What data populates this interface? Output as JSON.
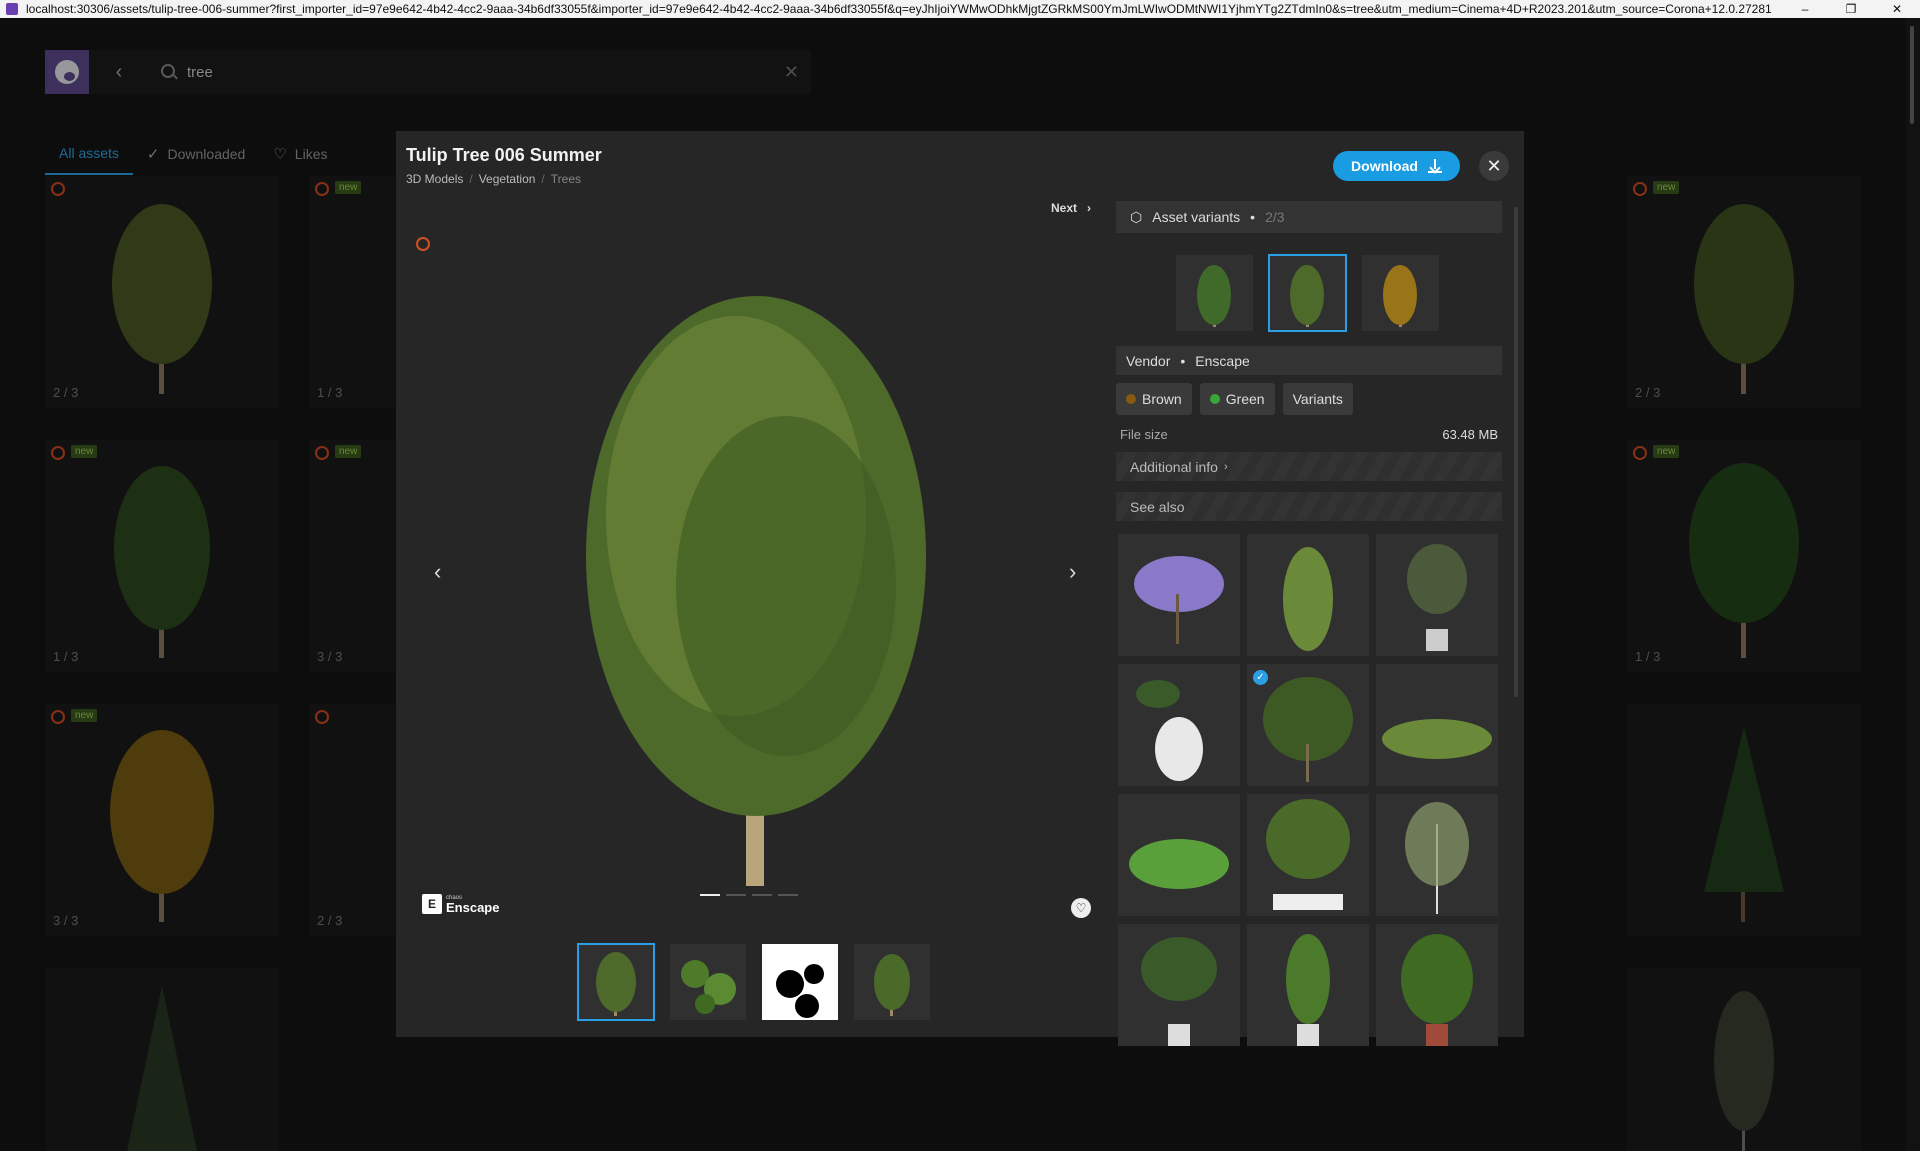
{
  "window": {
    "url": "localhost:30306/assets/tulip-tree-006-summer?first_importer_id=97e9e642-4b42-4cc2-9aaa-34b6df33055f&importer_id=97e9e642-4b42-4cc2-9aaa-34b6df33055f&q=eyJhIjoiYWMwODhkMjgtZGRkMS00YmJmLWIwODMtNWI1YjhmYTg2ZTdmIn0&s=tree&utm_medium=Cinema+4D+R2023.201&utm_source=Corona+12.0.27281",
    "controls": [
      "–",
      "❐",
      "✕"
    ]
  },
  "search": {
    "value": "tree"
  },
  "tabs": [
    {
      "label": "All assets",
      "icon": ""
    },
    {
      "label": "Downloaded",
      "icon": "✓"
    },
    {
      "label": "Likes",
      "icon": "♡"
    }
  ],
  "grid_cards": [
    {
      "new": "",
      "count": "2 / 3"
    },
    {
      "new": "new",
      "count": "1 / 3"
    },
    {
      "new": "new",
      "count": "1 / 3"
    },
    {
      "new": "new",
      "count": "3 / 3"
    },
    {
      "new": "new",
      "count": "3 / 3"
    },
    {
      "new": "",
      "count": "2 / 3"
    },
    {
      "new": "new",
      "count": "2 / 3"
    },
    {
      "new": "new",
      "count": "1 / 3"
    }
  ],
  "modal": {
    "title": "Tulip Tree 006 Summer",
    "breadcrumb": [
      "3D Models",
      "Vegetation",
      "Trees"
    ],
    "download_label": "Download",
    "next_label": "Next",
    "vendor_logo_small": "chaos",
    "vendor_logo": "Enscape",
    "variants_label": "Asset variants",
    "variants_count": "2/3",
    "vendor_label": "Vendor",
    "vendor_value": "Enscape",
    "chips": [
      {
        "label": "Brown",
        "color": "#8a5a12"
      },
      {
        "label": "Green",
        "color": "#3aa63a"
      },
      {
        "label": "Variants",
        "color": ""
      }
    ],
    "filesize_label": "File size",
    "filesize_value": "63.48 MB",
    "additional_info": "Additional info",
    "see_also": "See also"
  },
  "colors": {
    "accent": "#1a9ce3",
    "bg": "#141414",
    "panel": "#262626"
  }
}
